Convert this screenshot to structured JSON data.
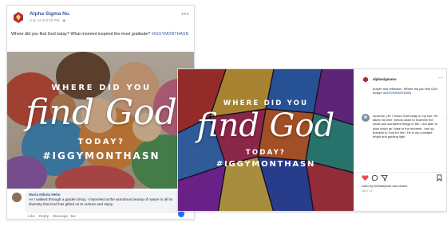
{
  "facebook_post": {
    "page_name": "Alpha Sigma Nu",
    "timestamp": "July 14 at 9:00 PM · ",
    "post_text": "Where did you find God today? What moment inspired the most gratitude? ",
    "hashtag": "#IGGYMONTHASN",
    "image_overlay": {
      "line1": "WHERE DID YOU",
      "script": "find God",
      "line3": "TODAY?",
      "hashtag": "#IGGYMONTHASN"
    },
    "comment": {
      "author": "Maria Nikola Helm",
      "text": "As I walked through a garden shop, I marveled at the wondrous beauty of nature in all its diversity that God has gifted us to nurture and enjoy."
    },
    "comment_actions": {
      "like": "Like",
      "reply": "Reply",
      "time": "Message · 5w"
    },
    "more_icon": "ellipsis-icon"
  },
  "instagram_post": {
    "username": "alphasigmanu",
    "caption": "prayer and reflection. Where did you find God today? ",
    "caption_hashtag": "#IGGYMONTHASN",
    "image_overlay": {
      "line1": "WHERE DID YOU",
      "script": "find God",
      "line3": "TODAY?",
      "hashtag": "#IGGYMONTHASN"
    },
    "comment": {
      "text": "suzanne_r87 I found God today in my son. He takes his time, bends down to examine the small and wonderful things in life. I am able to slow down as I take in the moment. I am so thankful to God for him. He is my constant bright and guiding light."
    },
    "likes_text": "Liked by bethanybarr and others",
    "date_text": "JULY 14",
    "icons": [
      "heart-icon",
      "comment-icon",
      "share-icon",
      "bookmark-icon"
    ]
  },
  "colors": {
    "facebook_link": "#385898",
    "instagram_heart": "#ed4956",
    "brand_red": "#b22a2e"
  }
}
